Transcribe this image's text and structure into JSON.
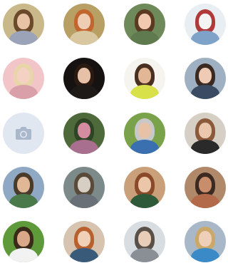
{
  "avatars": [
    {
      "row": 0,
      "col": 0,
      "kind": "photo",
      "bg": "#c9b98a",
      "hair": "#6b4a2b",
      "skin": "#e8c3a6",
      "cloth": "#9aa3b8"
    },
    {
      "row": 0,
      "col": 1,
      "kind": "photo",
      "bg": "#b8a064",
      "hair": "#c2652f",
      "skin": "#efcdb4",
      "cloth": "#d9c7a2"
    },
    {
      "row": 0,
      "col": 2,
      "kind": "photo",
      "bg": "#6f8a5a",
      "hair": "#5a3a22",
      "skin": "#f0c9b0",
      "cloth": "#5e7a4e"
    },
    {
      "row": 0,
      "col": 3,
      "kind": "photo",
      "bg": "#e9eef3",
      "hair": "#b03a3a",
      "skin": "#f4f4f4",
      "cloth": "#7fa2c8"
    },
    {
      "row": 1,
      "col": 0,
      "kind": "photo",
      "bg": "#f2c6c9",
      "hair": "#e8d6a8",
      "skin": "#f3d2c3",
      "cloth": "#d9a0aa"
    },
    {
      "row": 1,
      "col": 1,
      "kind": "photo",
      "bg": "#161211",
      "hair": "#2a1a12",
      "skin": "#e7c0a8",
      "cloth": "#1e1a18"
    },
    {
      "row": 1,
      "col": 2,
      "kind": "photo",
      "bg": "#f5f4ef",
      "hair": "#4a3020",
      "skin": "#e1b796",
      "cloth": "#d8e04a"
    },
    {
      "row": 1,
      "col": 3,
      "kind": "photo",
      "bg": "#9fb0c2",
      "hair": "#3a2a22",
      "skin": "#efcab4",
      "cloth": "#3a4a62"
    },
    {
      "row": 2,
      "col": 0,
      "kind": "placeholder",
      "bg": "#e1e7f0",
      "icon": "camera-icon",
      "icon_color": "#aab8cc"
    },
    {
      "row": 2,
      "col": 1,
      "kind": "photo",
      "bg": "#4f6a3a",
      "hair": "#2f4424",
      "skin": "#d48ca0",
      "cloth": "#a86f8f"
    },
    {
      "row": 2,
      "col": 2,
      "kind": "photo",
      "bg": "#7aa24a",
      "hair": "#c8c8c8",
      "skin": "#e8c2a6",
      "cloth": "#3a6fb0"
    },
    {
      "row": 2,
      "col": 3,
      "kind": "photo",
      "bg": "#d6cfc6",
      "hair": "#8a5a3a",
      "skin": "#ebc7ad",
      "cloth": "#2a2a2a"
    },
    {
      "row": 3,
      "col": 0,
      "kind": "photo",
      "bg": "#8fa9c4",
      "hair": "#4a3a2a",
      "skin": "#e0b898",
      "cloth": "#4a7a4a"
    },
    {
      "row": 3,
      "col": 1,
      "kind": "photo",
      "bg": "#7c8a8a",
      "hair": "#5a4a3a",
      "skin": "#d8cfc4",
      "cloth": "#6a7078"
    },
    {
      "row": 3,
      "col": 2,
      "kind": "photo",
      "bg": "#c9a07a",
      "hair": "#8a4a2a",
      "skin": "#ecc6a8",
      "cloth": "#2f5a3a"
    },
    {
      "row": 3,
      "col": 3,
      "kind": "photo",
      "bg": "#b0886a",
      "hair": "#3a2a22",
      "skin": "#c88e6c",
      "cloth": "#b36a4a"
    },
    {
      "row": 4,
      "col": 0,
      "kind": "photo",
      "bg": "#5e9a3a",
      "hair": "#3a2a1a",
      "skin": "#d9a888",
      "cloth": "#f2f2f2"
    },
    {
      "row": 4,
      "col": 1,
      "kind": "photo",
      "bg": "#d6c3b0",
      "hair": "#b8612f",
      "skin": "#f1d0b8",
      "cloth": "#3a5a7a"
    },
    {
      "row": 4,
      "col": 2,
      "kind": "photo",
      "bg": "#d8dde2",
      "hair": "#5a5048",
      "skin": "#e8cdb8",
      "cloth": "#8a8f96"
    },
    {
      "row": 4,
      "col": 3,
      "kind": "photo",
      "bg": "#a8b8c8",
      "hair": "#c9a86a",
      "skin": "#f0cfb8",
      "cloth": "#3a8ac8"
    }
  ]
}
